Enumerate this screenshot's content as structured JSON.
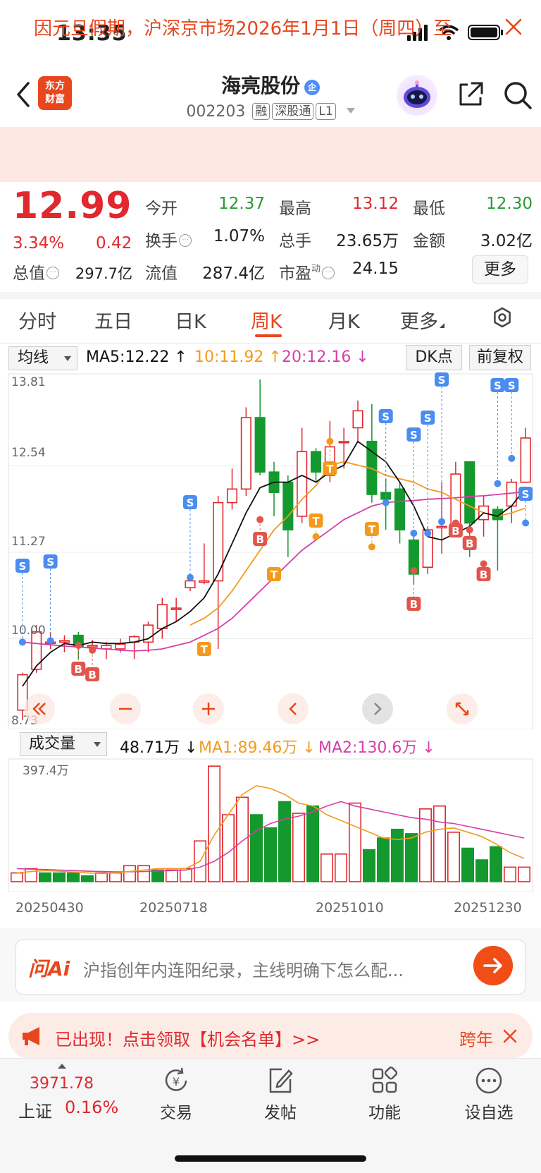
{
  "status_bar": {
    "time": "13:35"
  },
  "header": {
    "logo_line1": "东方",
    "logo_line2": "财富",
    "stock_name": "海亮股份",
    "name_badge": "企",
    "stock_code": "002203",
    "tags": [
      "融",
      "深股通",
      "L1"
    ]
  },
  "notice": {
    "text": "因元旦假期，沪深京市场2026年1月1日（周四）至"
  },
  "quote": {
    "price": "12.99",
    "change_pct": "3.34%",
    "change_abs": "0.42",
    "fields": {
      "open_label": "今开",
      "open": "12.37",
      "high_label": "最高",
      "high": "13.12",
      "low_label": "最低",
      "low": "12.30",
      "turnover_label": "换手",
      "turnover": "1.07%",
      "volume_label": "总手",
      "volume": "23.65万",
      "amount_label": "金额",
      "amount": "3.02亿",
      "mktcap_label": "总值",
      "mktcap": "297.7亿",
      "float_label": "流值",
      "float_cap": "287.4亿",
      "pe_label": "市盈",
      "pe_sup": "动",
      "pe": "24.15"
    },
    "more_label": "更多"
  },
  "period_tabs": [
    "分时",
    "五日",
    "日K",
    "周K",
    "月K",
    "更多"
  ],
  "active_tab": "周K",
  "chart_toolbar": {
    "indicator": "均线",
    "ma5": "MA5:12.22 ↑",
    "ma10": "10:11.92 ↑",
    "ma20": "20:12.16 ↓",
    "dk_label": "DK点",
    "adjust_label": "前复权"
  },
  "volume_toolbar": {
    "indicator": "成交量",
    "vol": "48.71万 ↓",
    "ma1": "MA1:89.46万 ↓",
    "ma2": "MA2:130.6万 ↓",
    "max_label": "397.4万"
  },
  "price_axis": [
    "13.81",
    "12.54",
    "11.27",
    "10.00",
    "8.73"
  ],
  "date_axis": [
    "20250430",
    "20250718",
    "20251010",
    "20251230"
  ],
  "signal_letters": {
    "buy": "B",
    "sell": "S",
    "take": "T"
  },
  "chart_data": {
    "type": "candlestick",
    "ylim": [
      8.73,
      13.81
    ],
    "candles": [
      {
        "o": 8.95,
        "c": 9.47,
        "h": 9.5,
        "l": 8.8
      },
      {
        "o": 9.55,
        "c": 10.1,
        "h": 10.2,
        "l": 9.5
      },
      {
        "o": 9.95,
        "c": 9.95,
        "h": 10.1,
        "l": 9.85
      },
      {
        "o": 9.95,
        "c": 9.97,
        "h": 10.05,
        "l": 9.8
      },
      {
        "o": 10.05,
        "c": 9.88,
        "h": 10.1,
        "l": 9.7
      },
      {
        "o": 9.9,
        "c": 9.9,
        "h": 9.98,
        "l": 9.85
      },
      {
        "o": 9.85,
        "c": 9.9,
        "h": 9.95,
        "l": 9.7
      },
      {
        "o": 9.85,
        "c": 9.92,
        "h": 10.0,
        "l": 9.8
      },
      {
        "o": 9.95,
        "c": 10.03,
        "h": 10.05,
        "l": 9.7
      },
      {
        "o": 9.95,
        "c": 10.2,
        "h": 10.25,
        "l": 9.8
      },
      {
        "o": 10.15,
        "c": 10.5,
        "h": 10.6,
        "l": 10.0
      },
      {
        "o": 10.45,
        "c": 10.45,
        "h": 10.6,
        "l": 10.25
      },
      {
        "o": 10.75,
        "c": 10.85,
        "h": 10.9,
        "l": 10.7
      },
      {
        "o": 10.85,
        "c": 10.85,
        "h": 11.4,
        "l": 10.8
      },
      {
        "o": 10.85,
        "c": 12.0,
        "h": 12.1,
        "l": 9.85
      },
      {
        "o": 12.0,
        "c": 12.2,
        "h": 12.5,
        "l": 11.9
      },
      {
        "o": 12.2,
        "c": 13.25,
        "h": 13.4,
        "l": 12.1
      },
      {
        "o": 13.25,
        "c": 12.45,
        "h": 13.81,
        "l": 12.4
      },
      {
        "o": 12.45,
        "c": 12.15,
        "h": 12.6,
        "l": 11.8
      },
      {
        "o": 12.3,
        "c": 11.6,
        "h": 12.4,
        "l": 11.2
      },
      {
        "o": 11.8,
        "c": 12.75,
        "h": 13.1,
        "l": 11.7
      },
      {
        "o": 12.75,
        "c": 12.45,
        "h": 12.8,
        "l": 12.3
      },
      {
        "o": 12.4,
        "c": 12.82,
        "h": 13.2,
        "l": 12.3
      },
      {
        "o": 12.9,
        "c": 12.9,
        "h": 13.1,
        "l": 12.5
      },
      {
        "o": 13.1,
        "c": 13.35,
        "h": 13.5,
        "l": 12.9
      },
      {
        "o": 12.9,
        "c": 12.12,
        "h": 13.45,
        "l": 12.0
      },
      {
        "o": 12.15,
        "c": 12.05,
        "h": 12.35,
        "l": 11.6
      },
      {
        "o": 12.2,
        "c": 11.6,
        "h": 12.3,
        "l": 11.4
      },
      {
        "o": 11.45,
        "c": 10.95,
        "h": 11.6,
        "l": 10.8
      },
      {
        "o": 11.05,
        "c": 11.6,
        "h": 11.65,
        "l": 10.95
      },
      {
        "o": 11.65,
        "c": 11.65,
        "h": 12.3,
        "l": 11.25
      },
      {
        "o": 11.55,
        "c": 12.42,
        "h": 12.6,
        "l": 11.5
      },
      {
        "o": 12.6,
        "c": 11.7,
        "h": 12.6,
        "l": 11.2
      },
      {
        "o": 11.75,
        "c": 11.95,
        "h": 12.1,
        "l": 11.5
      },
      {
        "o": 11.9,
        "c": 11.75,
        "h": 11.95,
        "l": 11.0
      },
      {
        "o": 11.95,
        "c": 12.3,
        "h": 12.35,
        "l": 11.7
      },
      {
        "o": 12.3,
        "c": 12.95,
        "h": 13.1,
        "l": 12.3
      }
    ],
    "ma5": [
      9.3,
      9.6,
      9.8,
      9.93,
      9.9,
      9.95,
      9.93,
      9.93,
      9.95,
      10.0,
      10.15,
      10.25,
      10.4,
      10.6,
      10.95,
      11.4,
      11.85,
      12.22,
      12.3,
      12.3,
      12.4,
      12.3,
      12.45,
      12.55,
      12.9,
      12.75,
      12.6,
      12.3,
      11.95,
      11.5,
      11.45,
      11.55,
      11.65,
      11.85,
      11.8,
      11.95,
      12.22
    ],
    "ma10": [
      null,
      null,
      null,
      null,
      null,
      null,
      null,
      null,
      null,
      null,
      null,
      null,
      10.2,
      10.3,
      10.45,
      10.7,
      11.0,
      11.3,
      11.6,
      11.8,
      12.05,
      12.25,
      12.55,
      12.6,
      12.55,
      12.5,
      12.4,
      12.35,
      12.3,
      12.2,
      12.15,
      12.05,
      11.95,
      11.85,
      11.8,
      11.85,
      11.92
    ],
    "ma20": [
      9.95,
      9.93,
      9.91,
      9.89,
      9.88,
      9.86,
      9.85,
      9.83,
      9.82,
      9.83,
      9.85,
      9.9,
      9.95,
      10.05,
      10.15,
      10.3,
      10.5,
      10.7,
      10.9,
      11.1,
      11.3,
      11.45,
      11.6,
      11.75,
      11.85,
      11.95,
      12.0,
      12.02,
      12.03,
      12.05,
      12.06,
      12.07,
      12.09,
      12.1,
      12.12,
      12.14,
      12.16
    ],
    "volume": [
      30,
      45,
      30,
      30,
      30,
      20,
      30,
      30,
      55,
      55,
      40,
      40,
      45,
      140,
      397,
      230,
      290,
      230,
      185,
      275,
      235,
      260,
      95,
      95,
      270,
      110,
      150,
      180,
      165,
      250,
      260,
      170,
      115,
      75,
      120,
      50,
      50
    ],
    "volume_up": [
      true,
      true,
      false,
      false,
      false,
      false,
      true,
      true,
      true,
      true,
      false,
      true,
      true,
      true,
      true,
      true,
      true,
      false,
      false,
      false,
      true,
      false,
      true,
      true,
      true,
      false,
      false,
      false,
      false,
      true,
      true,
      true,
      false,
      false,
      false,
      true,
      true
    ],
    "vol_ma1": [
      30,
      35,
      38,
      36,
      33,
      30,
      28,
      30,
      35,
      40,
      45,
      45,
      45,
      70,
      160,
      230,
      300,
      330,
      320,
      300,
      270,
      260,
      230,
      210,
      190,
      170,
      150,
      145,
      150,
      170,
      180,
      185,
      170,
      155,
      130,
      100,
      80
    ],
    "vol_ma2": [
      45,
      43,
      42,
      40,
      38,
      36,
      35,
      34,
      34,
      35,
      37,
      38,
      40,
      50,
      70,
      100,
      140,
      175,
      200,
      215,
      225,
      240,
      260,
      275,
      260,
      250,
      240,
      230,
      220,
      215,
      205,
      200,
      190,
      180,
      170,
      160,
      150
    ]
  },
  "ai_bar": {
    "logo": "问Ai",
    "placeholder": "沪指创年内连阳纪录，主线明确下怎么配..."
  },
  "promo": {
    "text": "已出现！点击领取【机会名单】>>",
    "right": "跨年"
  },
  "bottom_nav": {
    "index_value": "3971.78",
    "index_name": "上证",
    "index_pct": "0.16%",
    "items": [
      "交易",
      "发帖",
      "功能",
      "设自选"
    ]
  }
}
